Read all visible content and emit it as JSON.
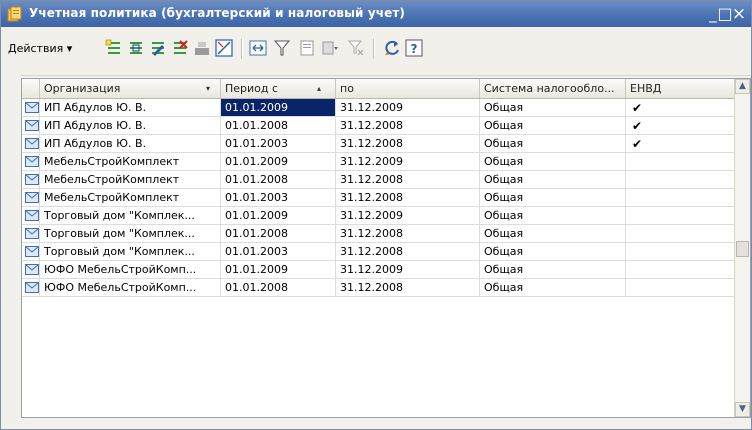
{
  "window": {
    "title": "Учетная политика (бухгалтерский и налоговый учет)",
    "minimize": "_",
    "maximize": "□",
    "close": "×"
  },
  "toolbar": {
    "actions_label": "Действия ▾",
    "icons": [
      "add-row-icon",
      "copy-row-icon",
      "edit-row-icon",
      "delete-row-icon",
      "hierarchy-icon",
      "mark-delete-icon",
      "range-icon",
      "filter-icon",
      "filter-by-value-icon",
      "filter-history-icon",
      "clear-filter-icon",
      "refresh-icon",
      "help-icon"
    ]
  },
  "grid": {
    "columns": [
      {
        "key": "icon",
        "label": ""
      },
      {
        "key": "org",
        "label": "Организация",
        "sort": "▾"
      },
      {
        "key": "from",
        "label": "Период с",
        "sort": "▴"
      },
      {
        "key": "to",
        "label": "по"
      },
      {
        "key": "tax",
        "label": "Система налогообло..."
      },
      {
        "key": "envd",
        "label": "ЕНВД"
      }
    ],
    "rows": [
      {
        "org": "ИП Абдулов Ю. В.",
        "from": "01.01.2009",
        "to": "31.12.2009",
        "tax": "Общая",
        "envd": "✔"
      },
      {
        "org": "ИП Абдулов Ю. В.",
        "from": "01.01.2008",
        "to": "31.12.2008",
        "tax": "Общая",
        "envd": "✔"
      },
      {
        "org": "ИП Абдулов Ю. В.",
        "from": "01.01.2003",
        "to": "31.12.2008",
        "tax": "Общая",
        "envd": "✔"
      },
      {
        "org": "МебельСтройКомплект",
        "from": "01.01.2009",
        "to": "31.12.2009",
        "tax": "Общая",
        "envd": ""
      },
      {
        "org": "МебельСтройКомплект",
        "from": "01.01.2008",
        "to": "31.12.2008",
        "tax": "Общая",
        "envd": ""
      },
      {
        "org": "МебельСтройКомплект",
        "from": "01.01.2003",
        "to": "31.12.2008",
        "tax": "Общая",
        "envd": ""
      },
      {
        "org": "Торговый дом \"Комплек...",
        "from": "01.01.2009",
        "to": "31.12.2009",
        "tax": "Общая",
        "envd": ""
      },
      {
        "org": "Торговый дом \"Комплек...",
        "from": "01.01.2008",
        "to": "31.12.2008",
        "tax": "Общая",
        "envd": ""
      },
      {
        "org": "Торговый дом \"Комплек...",
        "from": "01.01.2003",
        "to": "31.12.2008",
        "tax": "Общая",
        "envd": ""
      },
      {
        "org": "ЮФО МебельСтройКомп...",
        "from": "01.01.2009",
        "to": "31.12.2009",
        "tax": "Общая",
        "envd": ""
      },
      {
        "org": "ЮФО МебельСтройКомп...",
        "from": "01.01.2008",
        "to": "31.12.2008",
        "tax": "Общая",
        "envd": ""
      }
    ],
    "selected_row": 0,
    "selected_col": "from"
  },
  "colors": {
    "titlebar": "#4b72b3",
    "selection": "#0a246a",
    "icon_blue": "#3f6fb5",
    "icon_green": "#3a9a3a"
  }
}
